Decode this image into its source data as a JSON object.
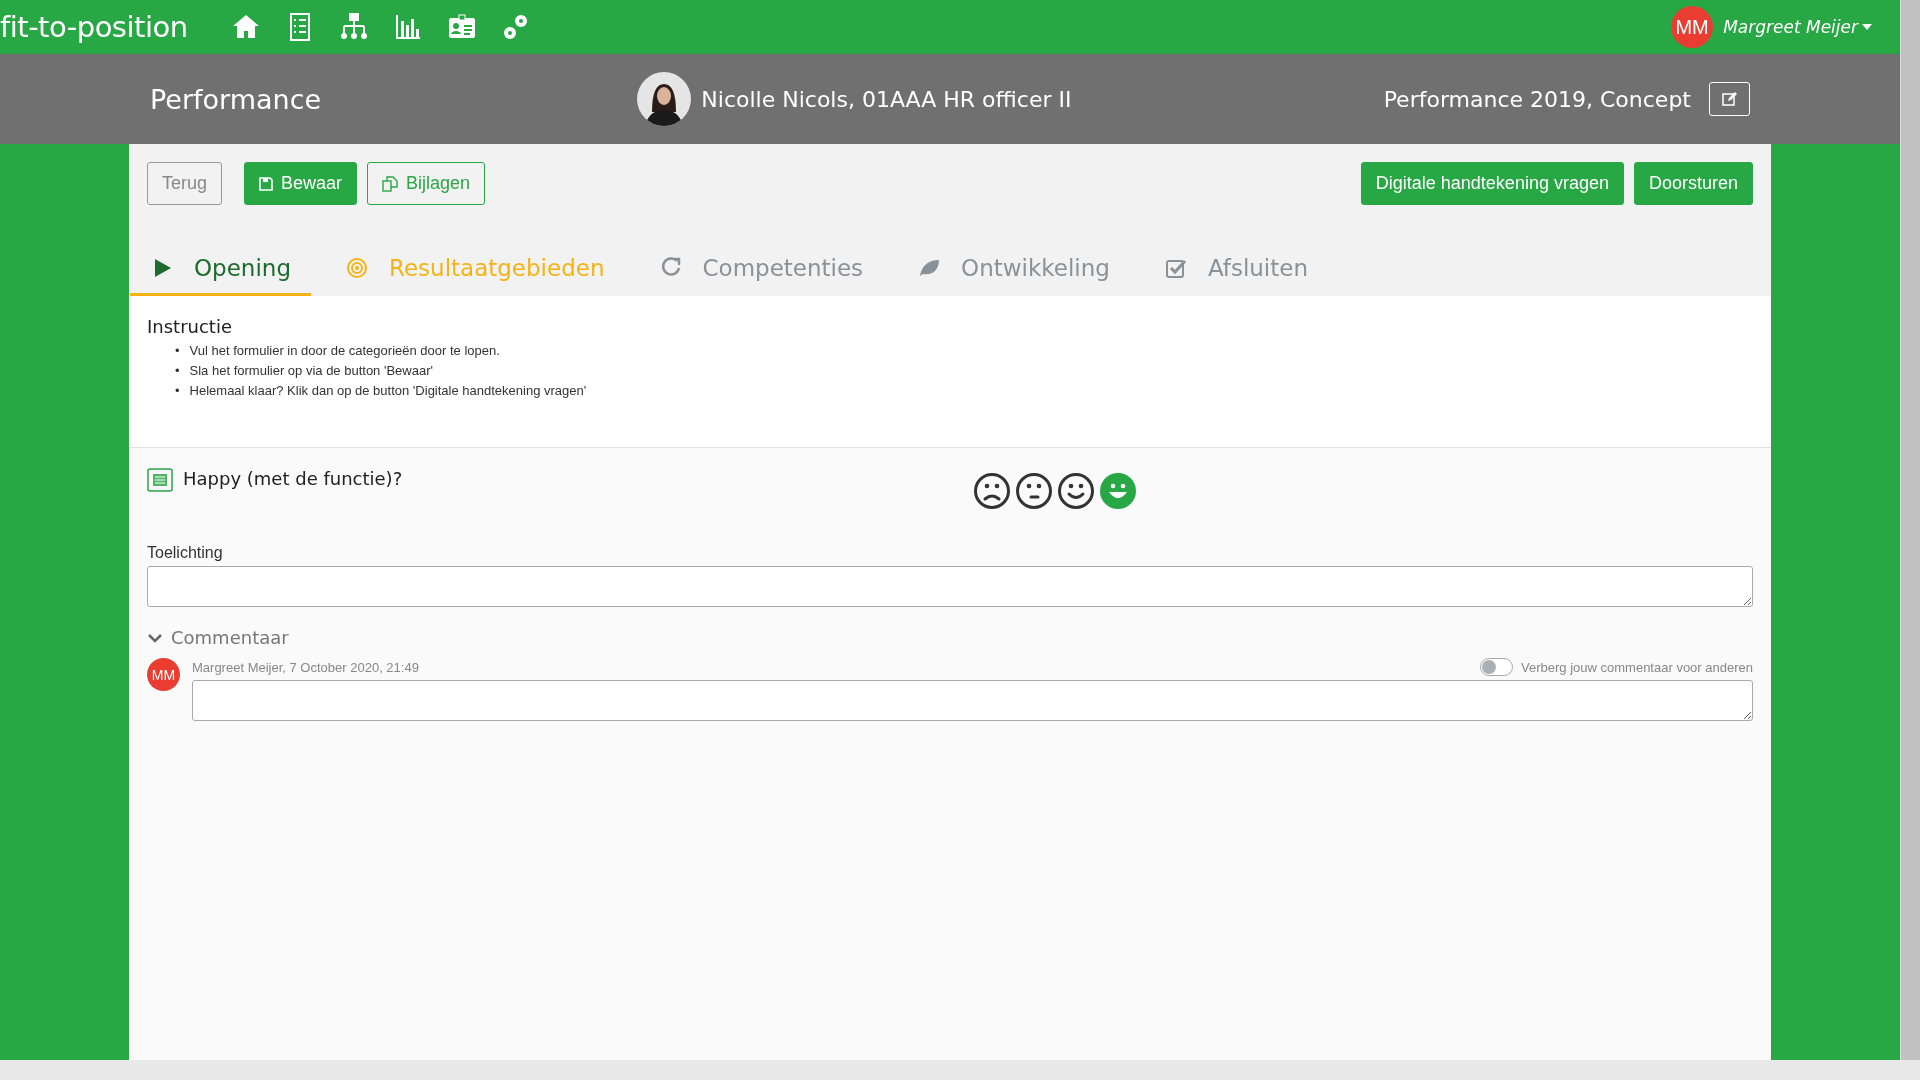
{
  "app": {
    "logo": "fit-to-position",
    "user": {
      "initials": "MM",
      "name": "Margreet Meijer"
    }
  },
  "header": {
    "title": "Performance",
    "employee": "Nicolle Nicols, 01AAA HR officer II",
    "document": "Performance 2019, Concept"
  },
  "toolbar": {
    "left_buttons": [
      {
        "label": "Terug",
        "kind": "plain"
      },
      {
        "label": "Bewaar",
        "kind": "primary"
      },
      {
        "label": "Bijlagen",
        "kind": "outline"
      }
    ],
    "right_buttons": [
      "Digitale handtekening vragen",
      "Doorsturen"
    ]
  },
  "tabs": [
    {
      "label": "Opening",
      "selected": true,
      "color": "#1e6b2e"
    },
    {
      "label": "Resultaatgebieden",
      "selected": false,
      "color": "#f5b316"
    },
    {
      "label": "Competenties",
      "selected": false,
      "color": "#8a9299"
    },
    {
      "label": "Ontwikkeling",
      "selected": false,
      "color": "#8a9299"
    },
    {
      "label": "Afsluiten",
      "selected": false,
      "color": "#8a9299"
    }
  ],
  "instruction": {
    "title": "Instructie",
    "bullet": "•",
    "items": [
      "Vul het formulier in door de categorieën door te lopen.",
      "Sla het formulier op via de button 'Bewaar'",
      "Helemaal klaar? Klik dan op de button 'Digitale handtekening vragen'"
    ]
  },
  "question": {
    "title": "Happy (met de functie)?",
    "ratings": [
      {
        "selected": false
      },
      {
        "selected": false
      },
      {
        "selected": false
      },
      {
        "selected": true
      }
    ],
    "field_label": "Toelichting"
  },
  "comments": {
    "title": "Commentaar",
    "expanded": true,
    "author_initials": "MM",
    "meta": "Margreet Meijer, 7 October 2020, 21:49",
    "hide_toggle": {
      "label": "Verberg jouw commentaar voor anderen",
      "on": false
    }
  }
}
